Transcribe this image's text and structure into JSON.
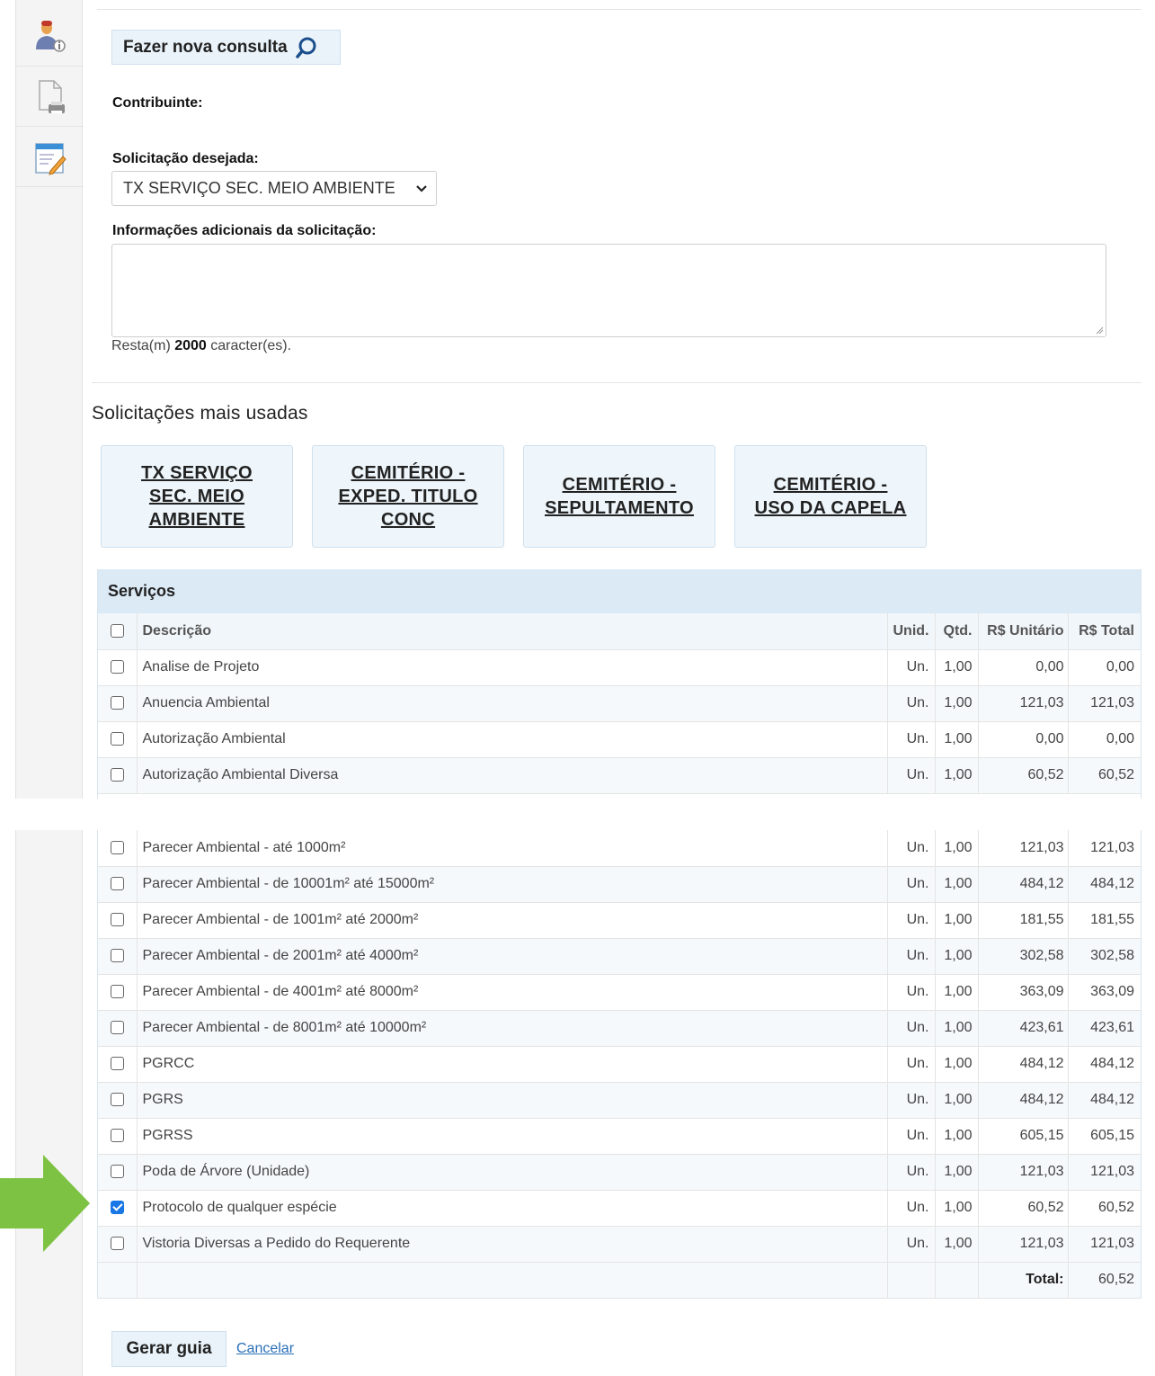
{
  "colors": {
    "accent_light": "#eaf3fa",
    "table_header": "#dceaf6",
    "arrow_green": "#7dc242",
    "checkbox_checked": "#1877e5",
    "link": "#2a6fb8"
  },
  "sidebar": {
    "icons": [
      "contributor-info-icon",
      "print-document-icon",
      "edit-form-icon"
    ]
  },
  "search_button": {
    "label": "Fazer nova consulta",
    "icon": "search-icon"
  },
  "form": {
    "contribuinte_label": "Contribuinte:",
    "solicitacao_label": "Solicitação desejada:",
    "solicitacao_value": "TX SERVIÇO SEC. MEIO AMBIENTE",
    "info_label": "Informações adicionais da solicitação:",
    "remaining_prefix": "Resta(m)",
    "remaining_count": "2000",
    "remaining_suffix": "caracter(es)."
  },
  "favorites": {
    "title": "Solicitações mais usadas",
    "items": [
      {
        "lines": [
          "TX SERVIÇO",
          "SEC. MEIO",
          "AMBIENTE"
        ]
      },
      {
        "lines": [
          "CEMITÉRIO -",
          "EXPED. TITULO",
          "CONC"
        ]
      },
      {
        "lines": [
          "CEMITÉRIO -",
          "SEPULTAMENTO"
        ]
      },
      {
        "lines": [
          "CEMITÉRIO -",
          "USO DA CAPELA"
        ]
      }
    ]
  },
  "services": {
    "title": "Serviços",
    "columns": [
      "Descrição",
      "Unid.",
      "Qtd.",
      "R$ Unitário",
      "R$ Total"
    ],
    "rows_top": [
      {
        "desc": "Analise de Projeto",
        "un": "Un.",
        "qtd": "1,00",
        "unit": "0,00",
        "total": "0,00",
        "checked": false
      },
      {
        "desc": "Anuencia Ambiental",
        "un": "Un.",
        "qtd": "1,00",
        "unit": "121,03",
        "total": "121,03",
        "checked": false
      },
      {
        "desc": "Autorização Ambiental",
        "un": "Un.",
        "qtd": "1,00",
        "unit": "0,00",
        "total": "0,00",
        "checked": false
      },
      {
        "desc": "Autorização Ambiental Diversa",
        "un": "Un.",
        "qtd": "1,00",
        "unit": "60,52",
        "total": "60,52",
        "checked": false
      }
    ],
    "rows_bottom": [
      {
        "desc": "Parecer Ambiental - até 1000m²",
        "un": "Un.",
        "qtd": "1,00",
        "unit": "121,03",
        "total": "121,03",
        "checked": false
      },
      {
        "desc": "Parecer Ambiental - de 10001m² até 15000m²",
        "un": "Un.",
        "qtd": "1,00",
        "unit": "484,12",
        "total": "484,12",
        "checked": false
      },
      {
        "desc": "Parecer Ambiental - de 1001m² até 2000m²",
        "un": "Un.",
        "qtd": "1,00",
        "unit": "181,55",
        "total": "181,55",
        "checked": false
      },
      {
        "desc": "Parecer Ambiental - de 2001m² até 4000m²",
        "un": "Un.",
        "qtd": "1,00",
        "unit": "302,58",
        "total": "302,58",
        "checked": false
      },
      {
        "desc": "Parecer Ambiental - de 4001m² até 8000m²",
        "un": "Un.",
        "qtd": "1,00",
        "unit": "363,09",
        "total": "363,09",
        "checked": false
      },
      {
        "desc": "Parecer Ambiental - de 8001m² até 10000m²",
        "un": "Un.",
        "qtd": "1,00",
        "unit": "423,61",
        "total": "423,61",
        "checked": false
      },
      {
        "desc": "PGRCC",
        "un": "Un.",
        "qtd": "1,00",
        "unit": "484,12",
        "total": "484,12",
        "checked": false
      },
      {
        "desc": "PGRS",
        "un": "Un.",
        "qtd": "1,00",
        "unit": "484,12",
        "total": "484,12",
        "checked": false
      },
      {
        "desc": "PGRSS",
        "un": "Un.",
        "qtd": "1,00",
        "unit": "605,15",
        "total": "605,15",
        "checked": false
      },
      {
        "desc": "Poda de Árvore (Unidade)",
        "un": "Un.",
        "qtd": "1,00",
        "unit": "121,03",
        "total": "121,03",
        "checked": false
      },
      {
        "desc": "Protocolo de qualquer espécie",
        "un": "Un.",
        "qtd": "1,00",
        "unit": "60,52",
        "total": "60,52",
        "checked": true
      },
      {
        "desc": "Vistoria Diversas a Pedido do Requerente",
        "un": "Un.",
        "qtd": "1,00",
        "unit": "121,03",
        "total": "121,03",
        "checked": false
      }
    ],
    "total_label": "Total:",
    "total_value": "60,52"
  },
  "actions": {
    "generate": "Gerar guia",
    "cancel": "Cancelar"
  }
}
